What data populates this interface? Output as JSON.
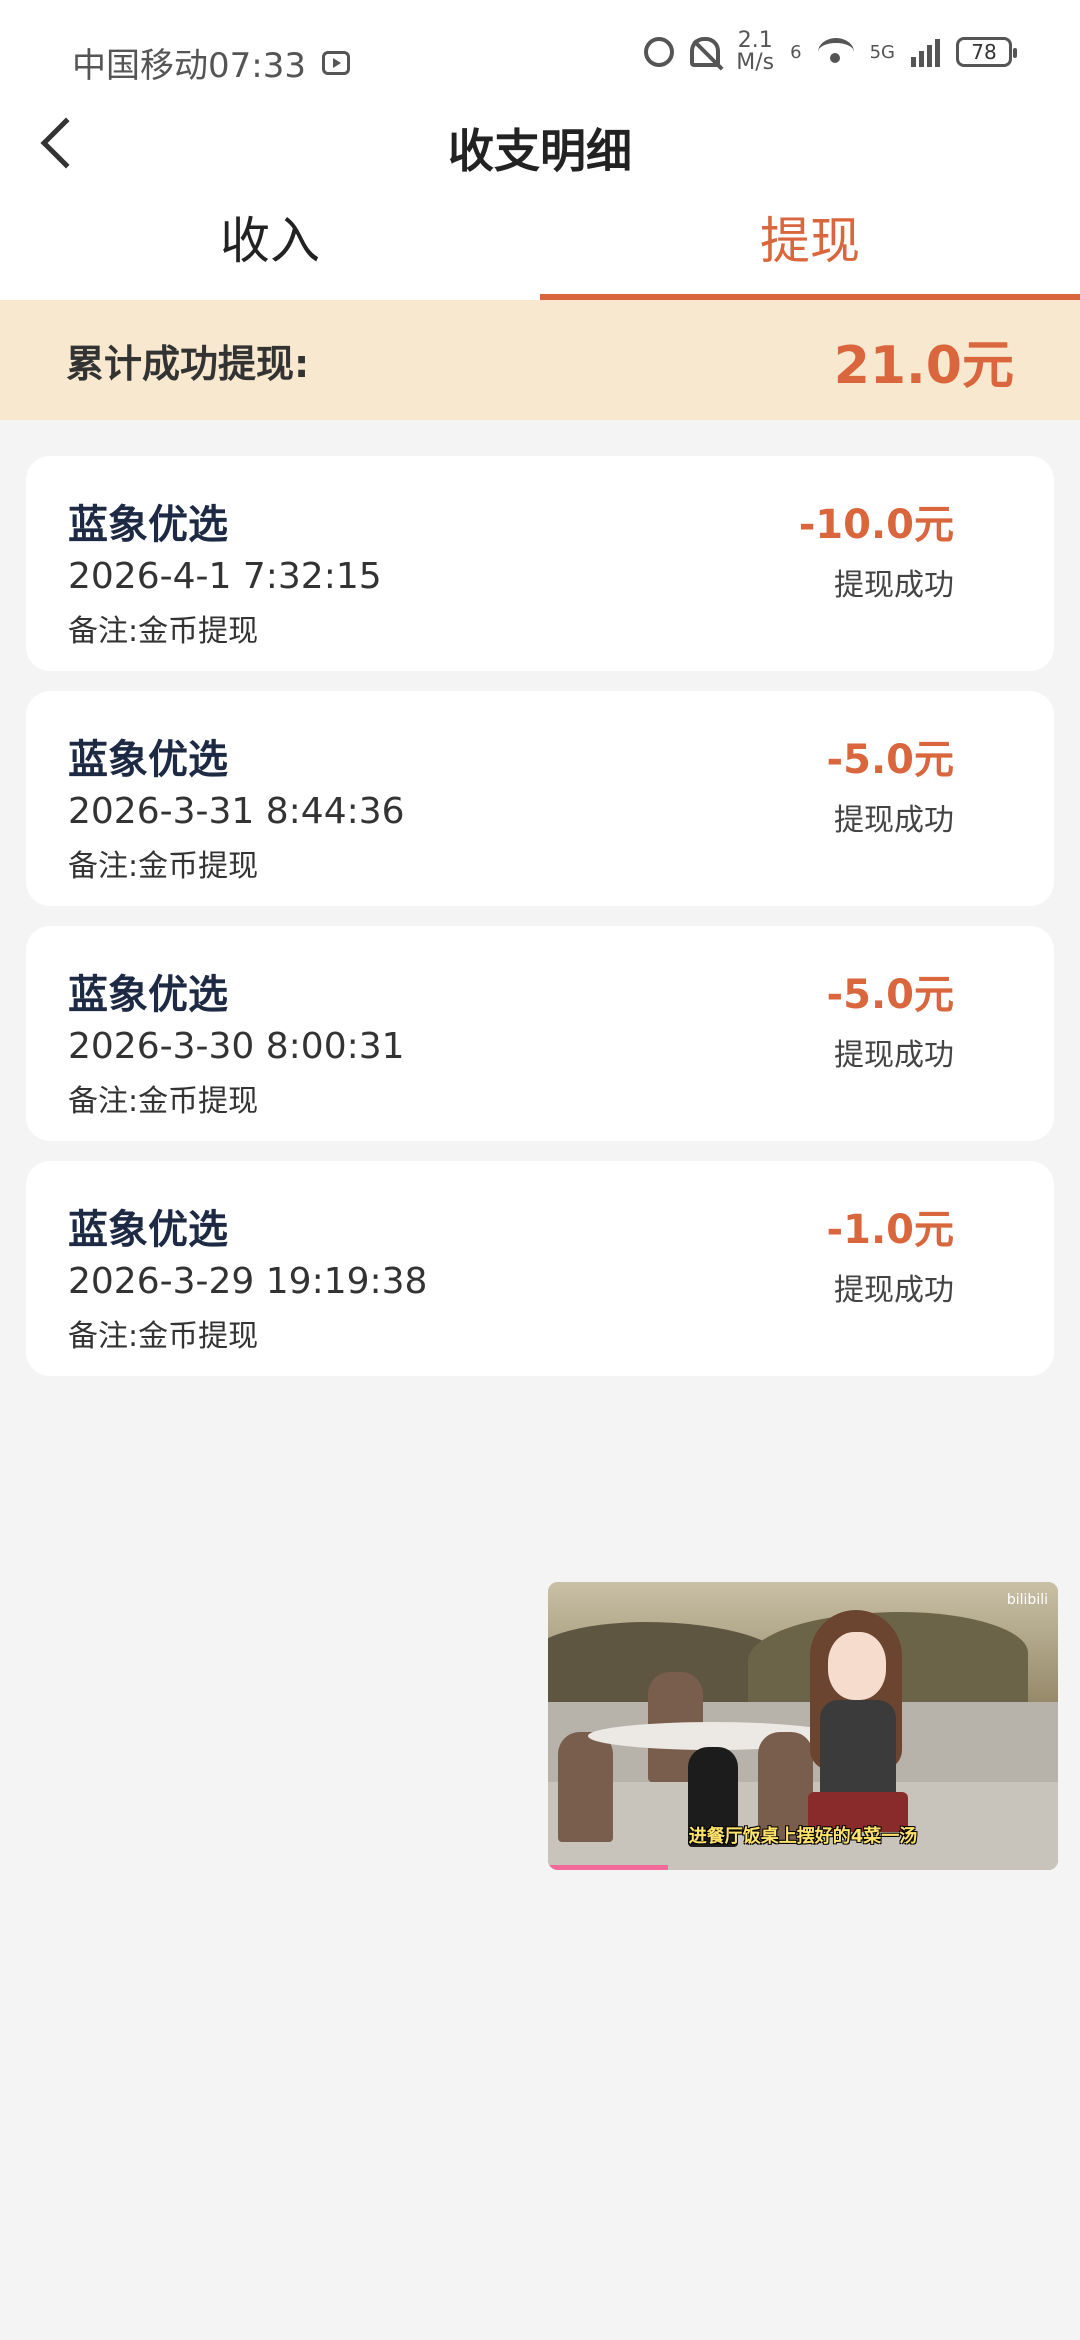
{
  "status_bar": {
    "carrier_time": "中国移动07:33",
    "speed_value": "2.1",
    "speed_unit": "M/s",
    "network_a": "6",
    "network_b": "5G",
    "battery": "78"
  },
  "header": {
    "title": "收支明细"
  },
  "tabs": [
    {
      "label": "收入",
      "active": false
    },
    {
      "label": "提现",
      "active": true
    }
  ],
  "summary": {
    "label": "累计成功提现:",
    "amount": "21.0元"
  },
  "records": [
    {
      "name": "蓝象优选",
      "time": "2026-4-1 7:32:15",
      "note": "备注:金币提现",
      "amount": "-10.0元",
      "status": "提现成功"
    },
    {
      "name": "蓝象优选",
      "time": "2026-3-31 8:44:36",
      "note": "备注:金币提现",
      "amount": "-5.0元",
      "status": "提现成功"
    },
    {
      "name": "蓝象优选",
      "time": "2026-3-30 8:00:31",
      "note": "备注:金币提现",
      "amount": "-5.0元",
      "status": "提现成功"
    },
    {
      "name": "蓝象优选",
      "time": "2026-3-29 19:19:38",
      "note": "备注:金币提现",
      "amount": "-1.0元",
      "status": "提现成功"
    }
  ],
  "floating_video": {
    "caption": "进餐厅饭桌上摆好的4菜一汤",
    "logo": "bilibili"
  },
  "colors": {
    "accent": "#d9663d",
    "summary_bg": "#f7e8cf",
    "page_bg": "#f4f4f4",
    "card_title": "#1e2a44"
  }
}
